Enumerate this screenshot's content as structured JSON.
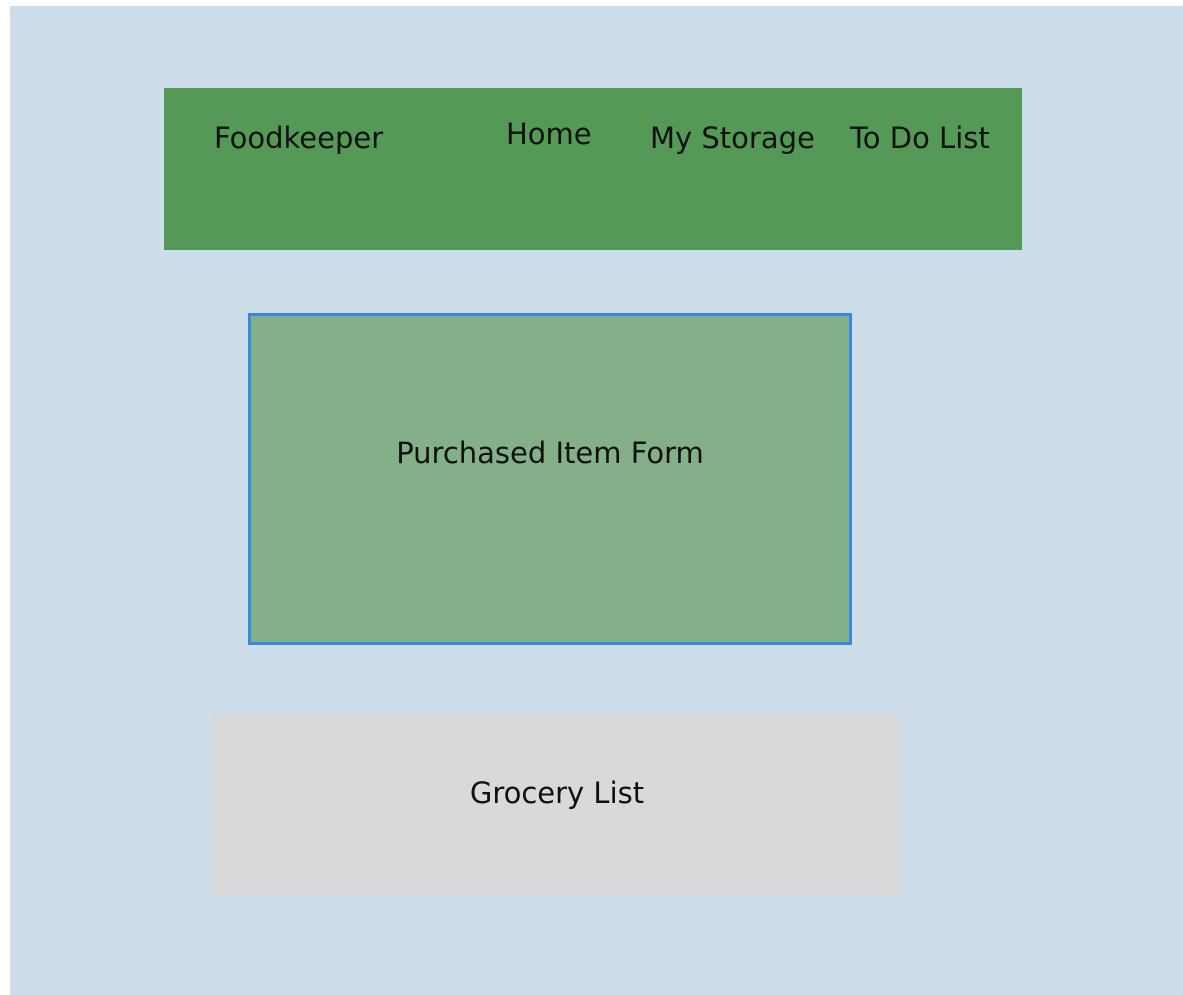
{
  "header": {
    "brand": "Foodkeeper",
    "nav": [
      {
        "label": "Home"
      },
      {
        "label": "My Storage"
      },
      {
        "label": "To Do List"
      }
    ]
  },
  "main": {
    "purchased_form": {
      "label": "Purchased Item Form"
    },
    "grocery_list": {
      "label": "Grocery List"
    }
  },
  "colors": {
    "background": "#cddde9",
    "navbar": "#549956",
    "form_panel": "#84b089",
    "form_border": "#3a86e0",
    "grocery_panel": "#d9d9d9"
  }
}
